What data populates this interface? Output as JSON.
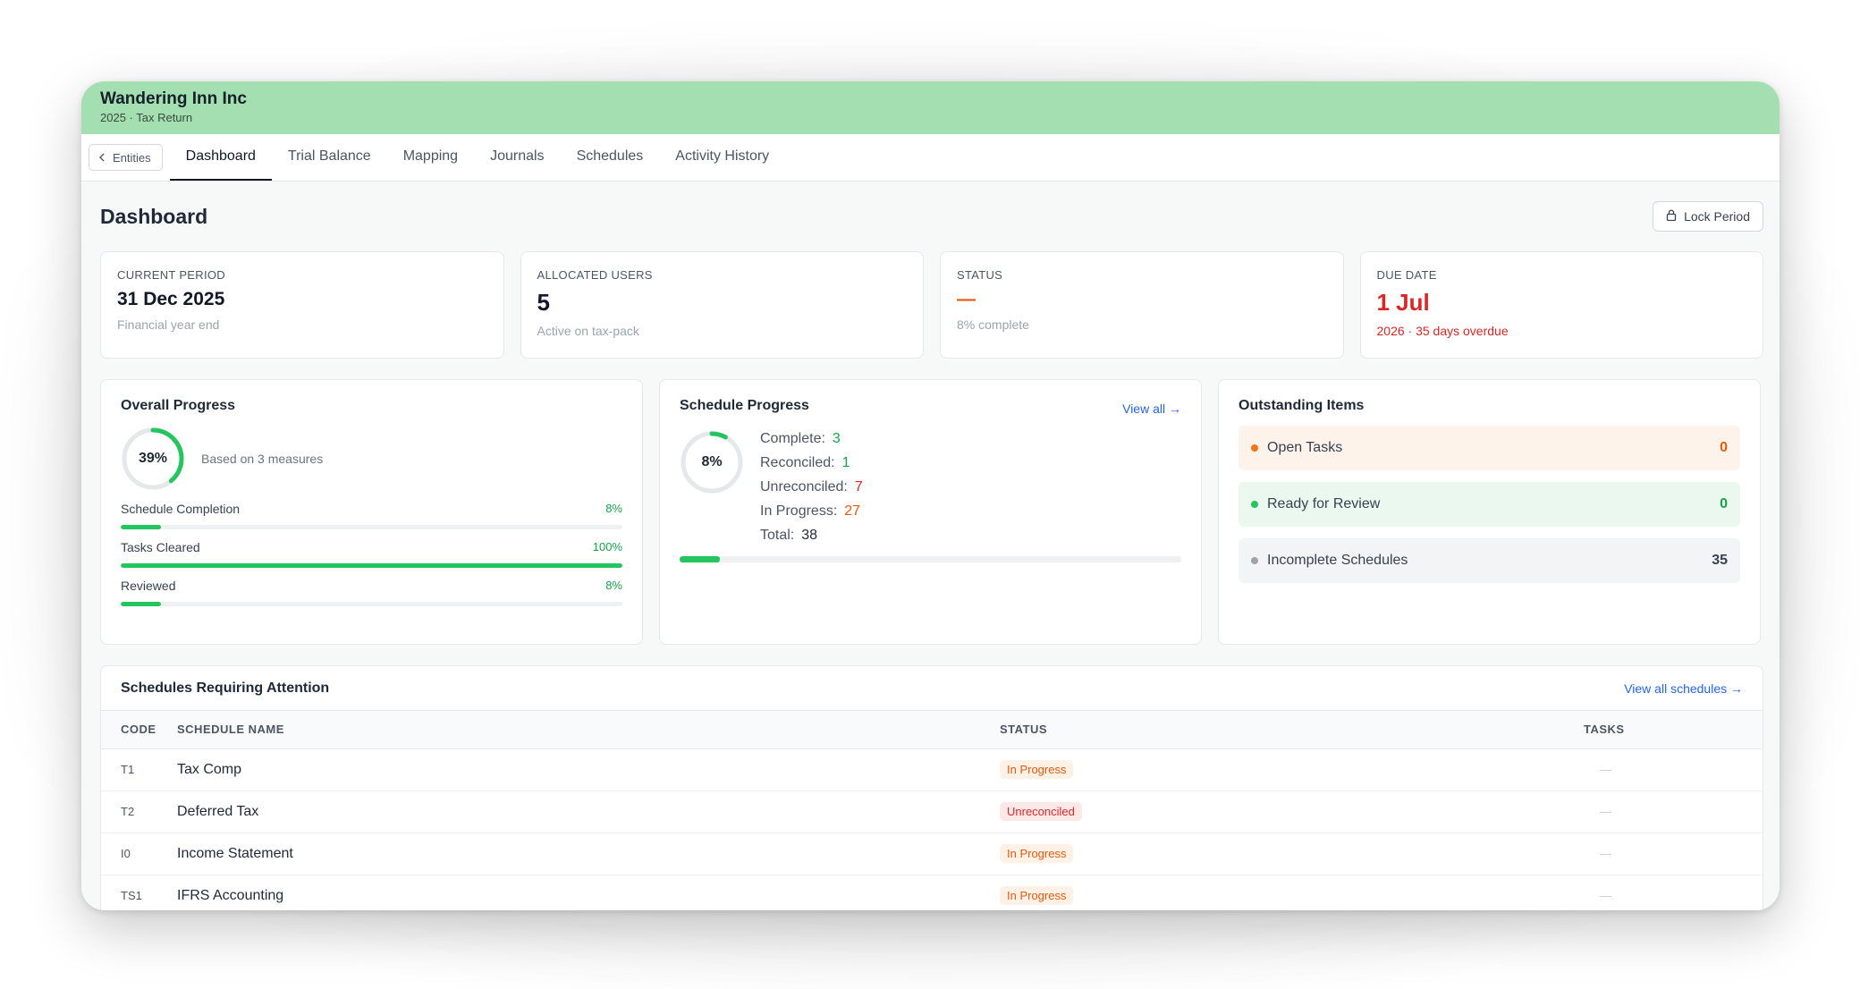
{
  "header": {
    "entity_name": "Wandering Inn Inc",
    "subtitle": "2025 · Tax Return"
  },
  "nav": {
    "back_label": "Entities",
    "tabs": [
      "Dashboard",
      "Trial Balance",
      "Mapping",
      "Journals",
      "Schedules",
      "Activity History"
    ],
    "active_tab": "Dashboard"
  },
  "page": {
    "title": "Dashboard",
    "lock_label": "Lock Period"
  },
  "stats": [
    {
      "label": "CURRENT PERIOD",
      "value": "31 Dec 2025",
      "note": "Financial year end"
    },
    {
      "label": "ALLOCATED USERS",
      "value": "5",
      "note": "Active on tax-pack"
    },
    {
      "label": "STATUS",
      "value": "—",
      "note": "8% complete"
    },
    {
      "label": "DUE DATE",
      "value": "1 Jul",
      "note": "2026 · 35 days overdue"
    }
  ],
  "overall": {
    "title": "Overall Progress",
    "percent_label": "39%",
    "percent": 39,
    "note": "Based on 3 measures",
    "metrics": [
      {
        "label": "Schedule Completion",
        "value_label": "8%",
        "value": 8
      },
      {
        "label": "Tasks Cleared",
        "value_label": "100%",
        "value": 100
      },
      {
        "label": "Reviewed",
        "value_label": "8%",
        "value": 8
      }
    ]
  },
  "schedule_progress": {
    "title": "Schedule Progress",
    "view_all": "View all →",
    "percent_label": "8%",
    "percent": 8,
    "items": [
      {
        "label": "Complete:",
        "value": "3"
      },
      {
        "label": "Reconciled:",
        "value": "1"
      },
      {
        "label": "Unreconciled:",
        "value": "7"
      },
      {
        "label": "In Progress:",
        "value": "27"
      },
      {
        "label": "Total:",
        "value": "38"
      }
    ],
    "colors": {
      "complete": "#16a34a",
      "reconciled": "#16a34a",
      "unreconciled": "#dc2626",
      "in_progress": "#ea580c",
      "total": "#1f2937"
    }
  },
  "outstanding": {
    "title": "Outstanding Items",
    "items": [
      {
        "label": "Open Tasks",
        "count": "0",
        "dot": "#f97316",
        "bg": "#fdf3ea",
        "count_color": "#ea580c"
      },
      {
        "label": "Ready for Review",
        "count": "0",
        "dot": "#22c55e",
        "bg": "#ebf8ef",
        "count_color": "#16a34a"
      },
      {
        "label": "Incomplete Schedules",
        "count": "35",
        "dot": "#9ca3af",
        "bg": "#f3f4f6",
        "count_color": "#374151"
      }
    ]
  },
  "attention": {
    "title": "Schedules Requiring Attention",
    "view_all": "View all schedules →",
    "columns": [
      "CODE",
      "SCHEDULE NAME",
      "STATUS",
      "TASKS"
    ],
    "rows": [
      {
        "code": "T1",
        "name": "Tax Comp",
        "status": "In Progress",
        "tasks": "—"
      },
      {
        "code": "T2",
        "name": "Deferred Tax",
        "status": "Unreconciled",
        "tasks": "—"
      },
      {
        "code": "I0",
        "name": "Income Statement",
        "status": "In Progress",
        "tasks": "—"
      },
      {
        "code": "TS1",
        "name": "IFRS Accounting",
        "status": "In Progress",
        "tasks": "—"
      }
    ]
  },
  "colors": {
    "header_bg": "#a3dfb0",
    "progress_green": "#22c55e",
    "overdue_red": "#dc2626",
    "status_orange": "#ea580c",
    "link_blue": "#2563eb"
  }
}
